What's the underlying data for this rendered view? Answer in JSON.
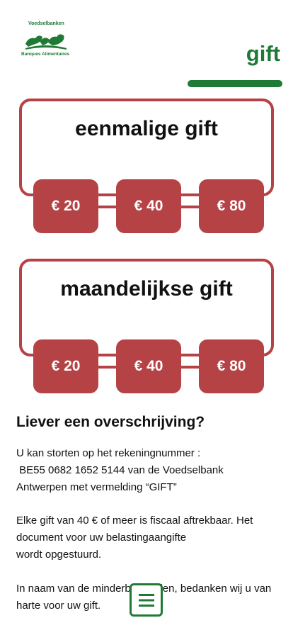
{
  "logo": {
    "top_text": "Voedselbanken",
    "bottom_text": "Banques Alimentaires"
  },
  "header": {
    "title": "gift"
  },
  "colors": {
    "brand_green": "#1f7a35",
    "accent_red": "#b54245"
  },
  "one_time": {
    "title": "eenmalige gift",
    "amounts": [
      "€ 20",
      "€ 40",
      "€ 80"
    ]
  },
  "monthly": {
    "title": "maandelijkse gift",
    "amounts": [
      "€ 20",
      "€ 40",
      "€ 80"
    ]
  },
  "transfer": {
    "heading": "Liever een overschrijving?",
    "p1_lines": [
      "U kan storten op het rekeningnummer :",
      " BE55 0682 1652 5144 van de Voedselbank",
      "Antwerpen met vermelding “GIFT”"
    ],
    "p2_lines": [
      "Elke gift van 40 € of meer is fiscaal aftrekbaar. Het",
      "document voor uw belastingaangifte",
      "wordt opgestuurd."
    ],
    "p3_lines": [
      "In naam van de minderbedeelden, bedanken wij u van",
      "harte voor uw gift."
    ]
  },
  "menu": {
    "icon": "hamburger-menu-icon"
  }
}
